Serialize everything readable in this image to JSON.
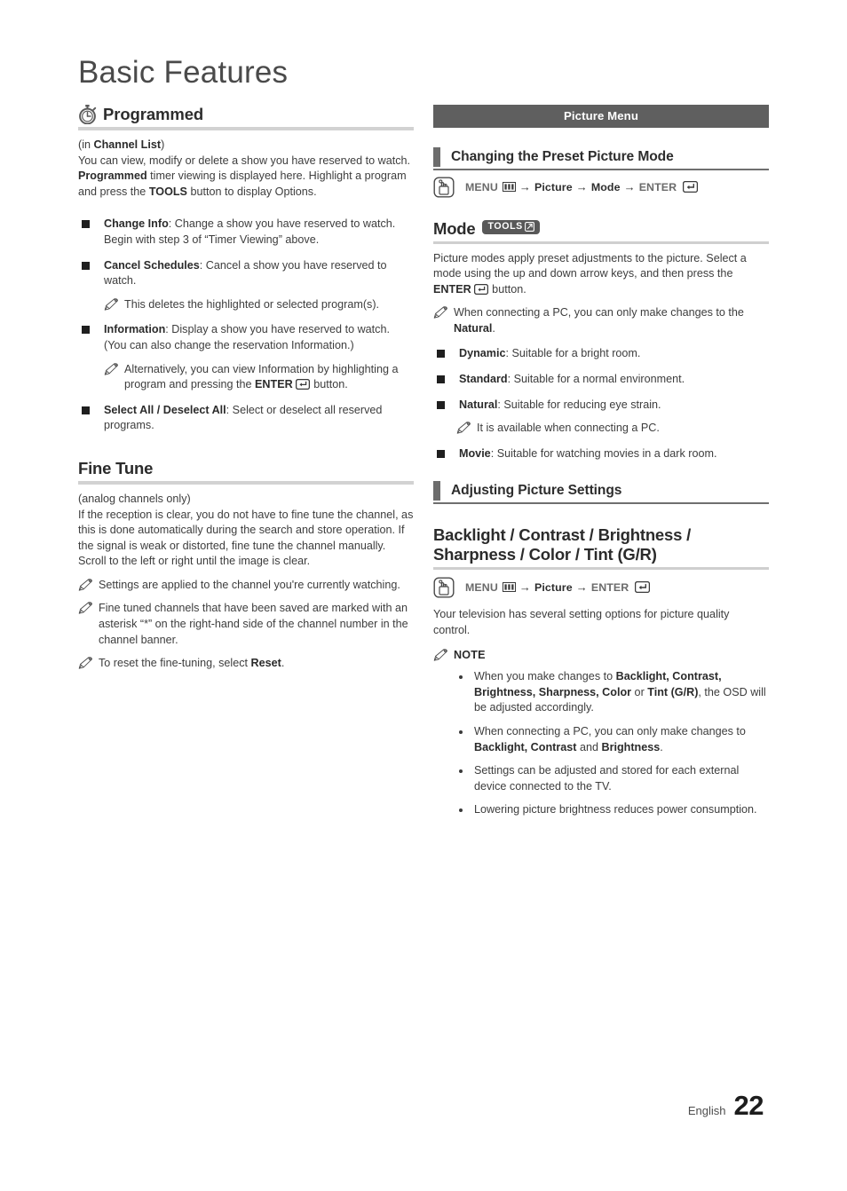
{
  "page": {
    "title": "Basic Features",
    "footer_language": "English",
    "footer_page_number": "22"
  },
  "colors": {
    "banner_bg": "#5f5f5f",
    "accent_bar": "#6d6d6d",
    "rule": "#d2d2d2",
    "body_text": "#3d3d3d",
    "bold_text": "#2b2b2b",
    "tools_badge_bg": "#585858"
  },
  "left_column": {
    "chapter": {
      "icon": "stopwatch-icon",
      "title": "Programmed",
      "subtitle_prefix": "(in ",
      "subtitle_bold": "Channel List",
      "subtitle_suffix": ")",
      "intro_1": "You can view, modify or delete a show you have reserved to watch. ",
      "intro_bold_1": "Programmed",
      "intro_2": " timer viewing is displayed here. Highlight a program and press the ",
      "intro_bold_2": "TOOLS",
      "intro_3": " button to display Options."
    },
    "bullets": [
      {
        "term": "Change Info",
        "text": ": Change a show you have reserved to watch. Begin with step 3 of “Timer Viewing” above.",
        "notes": []
      },
      {
        "term": "Cancel Schedules",
        "text": ": Cancel a show you have reserved to watch.",
        "notes": [
          {
            "icon": "pencil-note-icon",
            "text": "This deletes the highlighted or selected program(s)."
          }
        ]
      },
      {
        "term": "Information",
        "text": ": Display a show you have reserved to watch. (You can also change the reservation Information.)",
        "notes": [
          {
            "icon": "pencil-note-icon",
            "text_1": "Alternatively, you can view Information by highlighting a program and pressing the ",
            "bold": "ENTER",
            "enter_glyph": "enter-key-icon",
            "text_2": " button."
          }
        ]
      },
      {
        "term": "Select All / Deselect All",
        "text": ": Select or deselect all reserved programs.",
        "notes": []
      }
    ],
    "fine_tune": {
      "heading": "Fine Tune",
      "subtitle": "(analog channels only)",
      "body": "If the reception is clear, you do not have to fine tune the channel, as this is done automatically during the search and store operation. If the signal is weak or distorted, fine tune the channel manually. Scroll to the left or right until the image is clear.",
      "notes": [
        {
          "icon": "pencil-note-icon",
          "text": "Settings are applied to the channel you're currently watching."
        },
        {
          "icon": "pencil-note-icon",
          "text": "Fine tuned channels that have been saved are marked with an asterisk “*” on the right-hand side of the channel number in the channel banner."
        },
        {
          "icon": "pencil-note-icon",
          "text_1": "To reset the fine-tuning, select ",
          "bold": "Reset",
          "text_2": "."
        }
      ]
    }
  },
  "right_column": {
    "banner": "Picture Menu",
    "section_1": {
      "heading": "Changing the Preset Picture Mode",
      "menu_path": {
        "icon": "hand-press-icon",
        "menu_label": "MENU",
        "menu_glyph": "menu-bars-icon",
        "steps": [
          "Picture",
          "Mode"
        ],
        "enter_label": "ENTER",
        "enter_glyph": "enter-key-icon",
        "arrow": "→"
      }
    },
    "mode": {
      "heading": "Mode",
      "tools_badge": "TOOLS",
      "tools_glyph": "tools-arrow-icon",
      "body_1": "Picture modes apply preset adjustments to the picture. Select a mode using the up and down arrow keys, and then press the ",
      "body_bold": "ENTER",
      "body_enter_glyph": "enter-key-icon",
      "body_2": " button.",
      "note": {
        "icon": "pencil-note-icon",
        "text_1": "When connecting a PC, you can only make changes to the ",
        "bold": "Natural",
        "text_2": "."
      },
      "bullets": [
        {
          "term": "Dynamic",
          "text": ": Suitable for a bright room.",
          "notes": []
        },
        {
          "term": "Standard",
          "text": ": Suitable for a normal environment.",
          "notes": []
        },
        {
          "term": "Natural",
          "text": ": Suitable for reducing eye strain.",
          "notes": [
            {
              "icon": "pencil-note-icon",
              "text": "It is available when connecting a PC."
            }
          ]
        },
        {
          "term": "Movie",
          "text": ": Suitable for watching movies in a dark room.",
          "notes": []
        }
      ]
    },
    "section_2": {
      "heading": "Adjusting Picture Settings"
    },
    "backlight": {
      "heading_line_1": "Backlight / Contrast / Brightness /",
      "heading_line_2": "Sharpness / Color / Tint (G/R)",
      "menu_path": {
        "icon": "hand-press-icon",
        "menu_label": "MENU",
        "menu_glyph": "menu-bars-icon",
        "steps": [
          "Picture"
        ],
        "enter_label": "ENTER",
        "enter_glyph": "enter-key-icon",
        "arrow": "→"
      },
      "body": "Your television has several setting options for picture quality control.",
      "note_heading": "NOTE",
      "note_icon": "pencil-note-icon",
      "note_bullets": [
        {
          "t1": "When you make changes to ",
          "b1": "Backlight, Contrast, Brightness, Sharpness, Color",
          "t2": " or ",
          "b2": "Tint (G/R)",
          "t3": ", the OSD will be adjusted accordingly."
        },
        {
          "t1": "When connecting a PC, you can only make changes to ",
          "b1": "Backlight, Contrast",
          "t2": " and ",
          "b2": "Brightness",
          "t3": "."
        },
        {
          "t1": "Settings can be adjusted and stored for each external device connected to the TV.",
          "b1": "",
          "t2": "",
          "b2": "",
          "t3": ""
        },
        {
          "t1": "Lowering picture brightness reduces power consumption.",
          "b1": "",
          "t2": "",
          "b2": "",
          "t3": ""
        }
      ]
    }
  }
}
